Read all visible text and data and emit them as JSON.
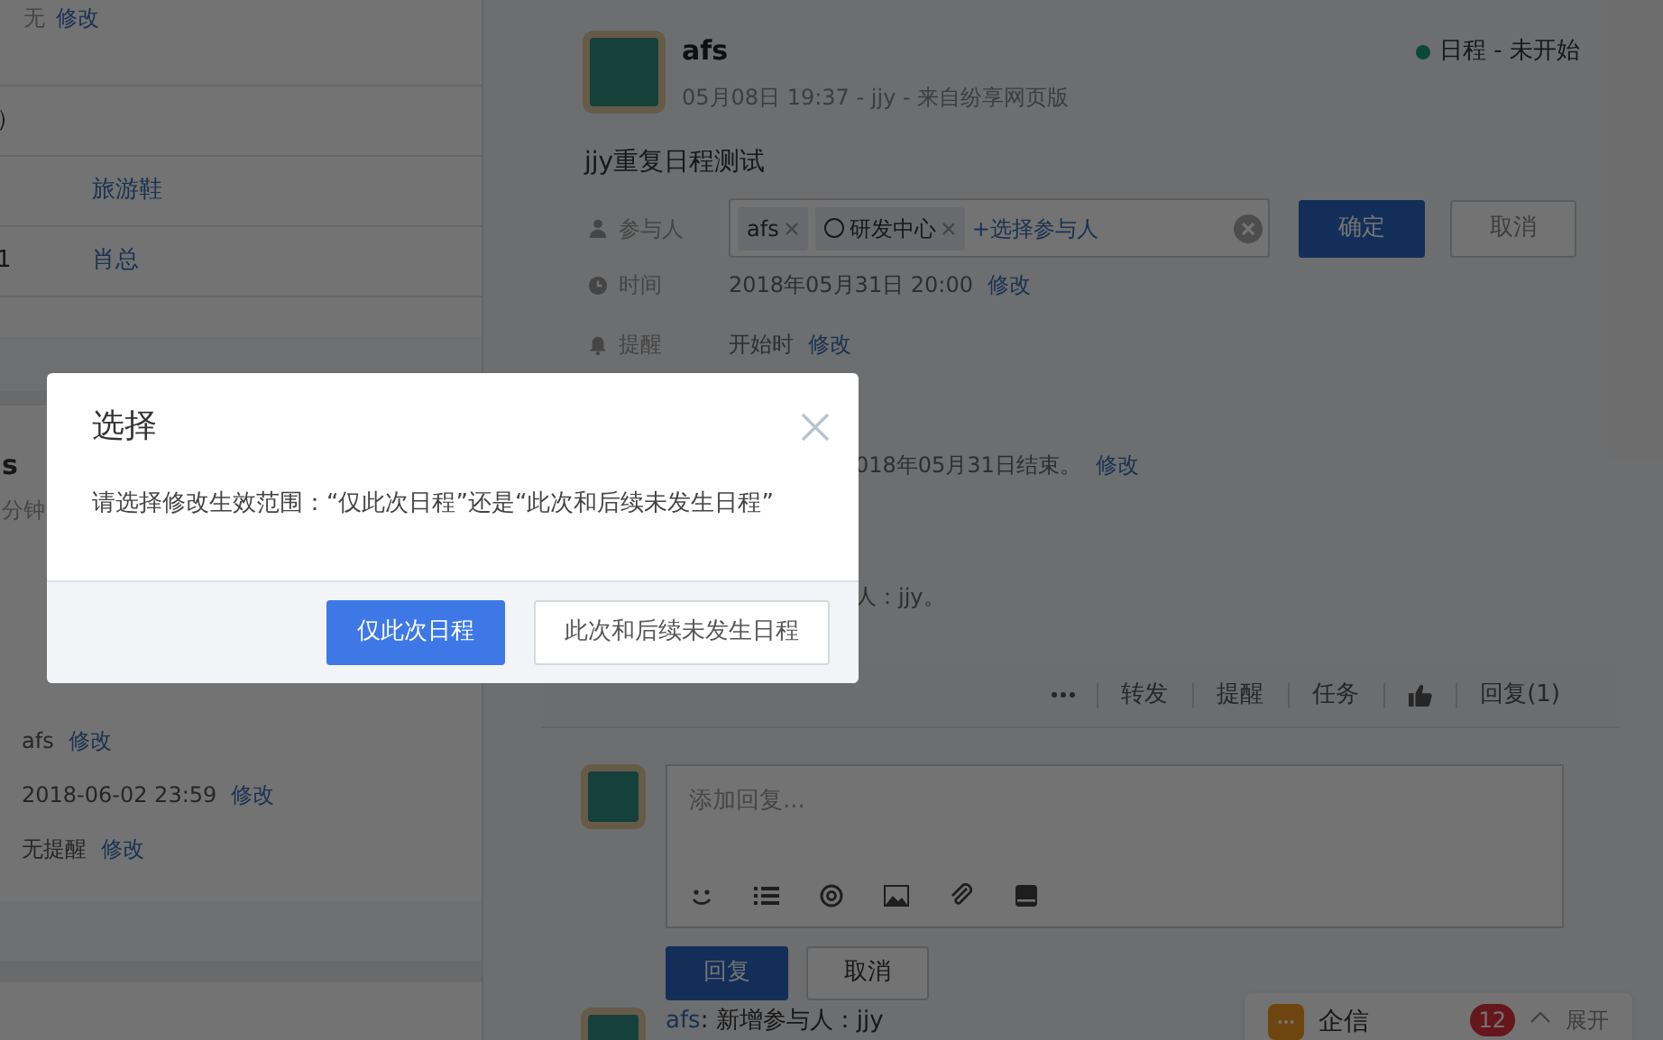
{
  "left_panel": {
    "top_value": "无",
    "top_link": "修改",
    "rows": [
      {
        "label": "）",
        "value": ""
      },
      {
        "label": "",
        "value": "旅游鞋"
      },
      {
        "label": "1",
        "value": "肖总"
      }
    ],
    "author_fragment": "s",
    "time_fragment": "分钟",
    "fields": [
      {
        "value": "afs",
        "link": "修改"
      },
      {
        "value": "2018-06-02 23:59",
        "link": "修改"
      },
      {
        "value": "无提醒",
        "link": "修改"
      }
    ]
  },
  "post": {
    "author": "afs",
    "meta": "05月08日 19:37 - jjy - 来自纷享网页版",
    "status": "日程 - 未开始",
    "title": "jjy重复日程测试",
    "participants": {
      "label": "参与人",
      "chips": [
        {
          "text": "afs",
          "kind": "person"
        },
        {
          "text": "研发中心",
          "kind": "department"
        }
      ],
      "add_link": "+选择参与人",
      "confirm": "确定",
      "cancel": "取消"
    },
    "time": {
      "label": "时间",
      "value": "2018年05月31日 20:00",
      "link": "修改"
    },
    "reminder": {
      "label": "提醒",
      "value": "开始时",
      "link": "修改"
    },
    "repeat": {
      "value": "018年05月31日结束。",
      "link": "修改"
    },
    "people_fragment": "人：jjy。",
    "actions": [
      "转发",
      "提醒",
      "任务",
      "回复(1)"
    ],
    "reply": {
      "placeholder": "添加回复...",
      "submit": "回复",
      "cancel": "取消"
    },
    "comment": {
      "author": "afs",
      "text": ": 新增参与人：jjy"
    }
  },
  "dialog": {
    "title": "选择",
    "message": "请选择修改生效范围：“仅此次日程”还是“此次和后续未发生日程”",
    "buttons": [
      {
        "label": "仅此次日程",
        "selected": true
      },
      {
        "label": "此次和后续未发生日程",
        "selected": false
      }
    ]
  },
  "chat_widget": {
    "title": "企信",
    "count": "12",
    "expand": "展开"
  }
}
